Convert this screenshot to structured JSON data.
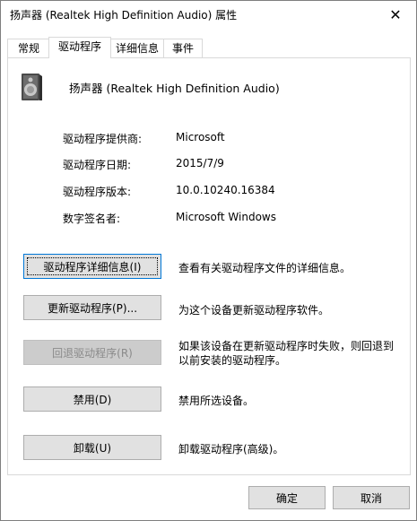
{
  "window": {
    "title": "扬声器 (Realtek High Definition Audio) 属性",
    "close_symbol": "✕"
  },
  "tabs": [
    "常规",
    "驱动程序",
    "详细信息",
    "事件"
  ],
  "active_tab": "驱动程序",
  "device": {
    "icon": "speaker-icon",
    "name": "扬声器 (Realtek High Definition Audio)"
  },
  "properties": [
    {
      "label": "驱动程序提供商:",
      "value": "Microsoft"
    },
    {
      "label": "驱动程序日期:",
      "value": "2015/7/9"
    },
    {
      "label": "驱动程序版本:",
      "value": "10.0.10240.16384"
    },
    {
      "label": "数字签名者:",
      "value": "Microsoft Windows"
    }
  ],
  "actions": [
    {
      "label": "驱动程序详细信息(I)",
      "description": "查看有关驱动程序文件的详细信息。",
      "state": "focused"
    },
    {
      "label": "更新驱动程序(P)...",
      "description": "为这个设备更新驱动程序软件。",
      "state": "normal"
    },
    {
      "label": "回退驱动程序(R)",
      "description": "如果该设备在更新驱动程序时失败，则回退到以前安装的驱动程序。",
      "state": "disabled"
    },
    {
      "label": "禁用(D)",
      "description": "禁用所选设备。",
      "state": "normal"
    },
    {
      "label": "卸载(U)",
      "description": "卸载驱动程序(高级)。",
      "state": "normal"
    }
  ],
  "footer": {
    "ok_label": "确定",
    "cancel_label": "取消"
  },
  "colors": {
    "focus_border": "#0078d7",
    "button_face": "#e1e1e1",
    "disabled_face": "#cccccc",
    "disabled_text": "#8a8a8a"
  }
}
